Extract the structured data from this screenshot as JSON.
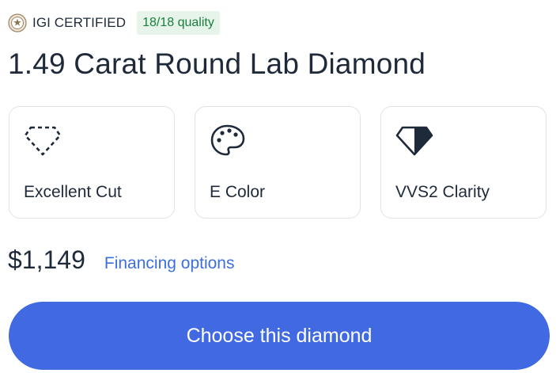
{
  "certification": {
    "seal_icon": "igi-seal-icon",
    "label": "IGI CERTIFIED",
    "quality_badge": "18/18 quality"
  },
  "product": {
    "title": "1.49 Carat Round Lab Diamond"
  },
  "attributes": [
    {
      "icon": "diamond-outline-icon",
      "label": "Excellent Cut"
    },
    {
      "icon": "palette-icon",
      "label": "E Color"
    },
    {
      "icon": "diamond-filled-icon",
      "label": "VVS2 Clarity"
    }
  ],
  "pricing": {
    "price": "$1,149",
    "financing_link": "Financing options"
  },
  "cta": {
    "label": "Choose this diamond"
  },
  "colors": {
    "text": "#1e2a3a",
    "accent": "#4169e1",
    "link": "#3b6fe0",
    "badge_bg": "#e6f4ea",
    "badge_text": "#1a7f3c",
    "card_border": "#dfe3e8"
  }
}
